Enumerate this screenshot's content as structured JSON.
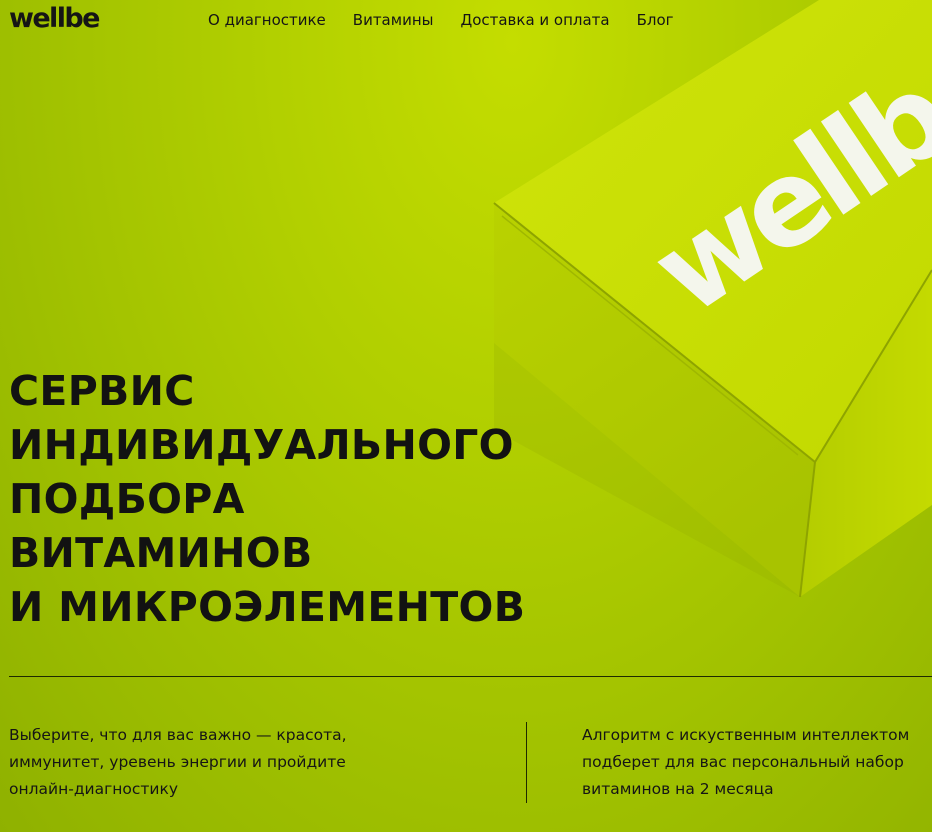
{
  "header": {
    "logo": "wellbe",
    "nav": [
      {
        "label": "О диагностике"
      },
      {
        "label": "Витамины"
      },
      {
        "label": "Доставка и оплата"
      },
      {
        "label": "Блог"
      }
    ]
  },
  "hero": {
    "title_lines": [
      "СЕРВИС",
      "ИНДИВИДУАЛЬНОГО",
      "ПОДБОРА",
      "ВИТАМИНОВ",
      "И МИКРОЭЛЕМЕНТОВ"
    ],
    "box_logo": "wellbe"
  },
  "features": {
    "left_lines": [
      "Выберите, что для вас важно — красота,",
      "иммунитет, уревень энергии и пройдите",
      "онлайн-диагностику"
    ],
    "right_lines": [
      "Алгоритм с искуственным интеллектом",
      "подберет для вас персональный набор",
      "витаминов на 2 месяца"
    ]
  },
  "colors": {
    "background": "#b1cf00",
    "text": "#121212",
    "box": "#c7dc00"
  }
}
